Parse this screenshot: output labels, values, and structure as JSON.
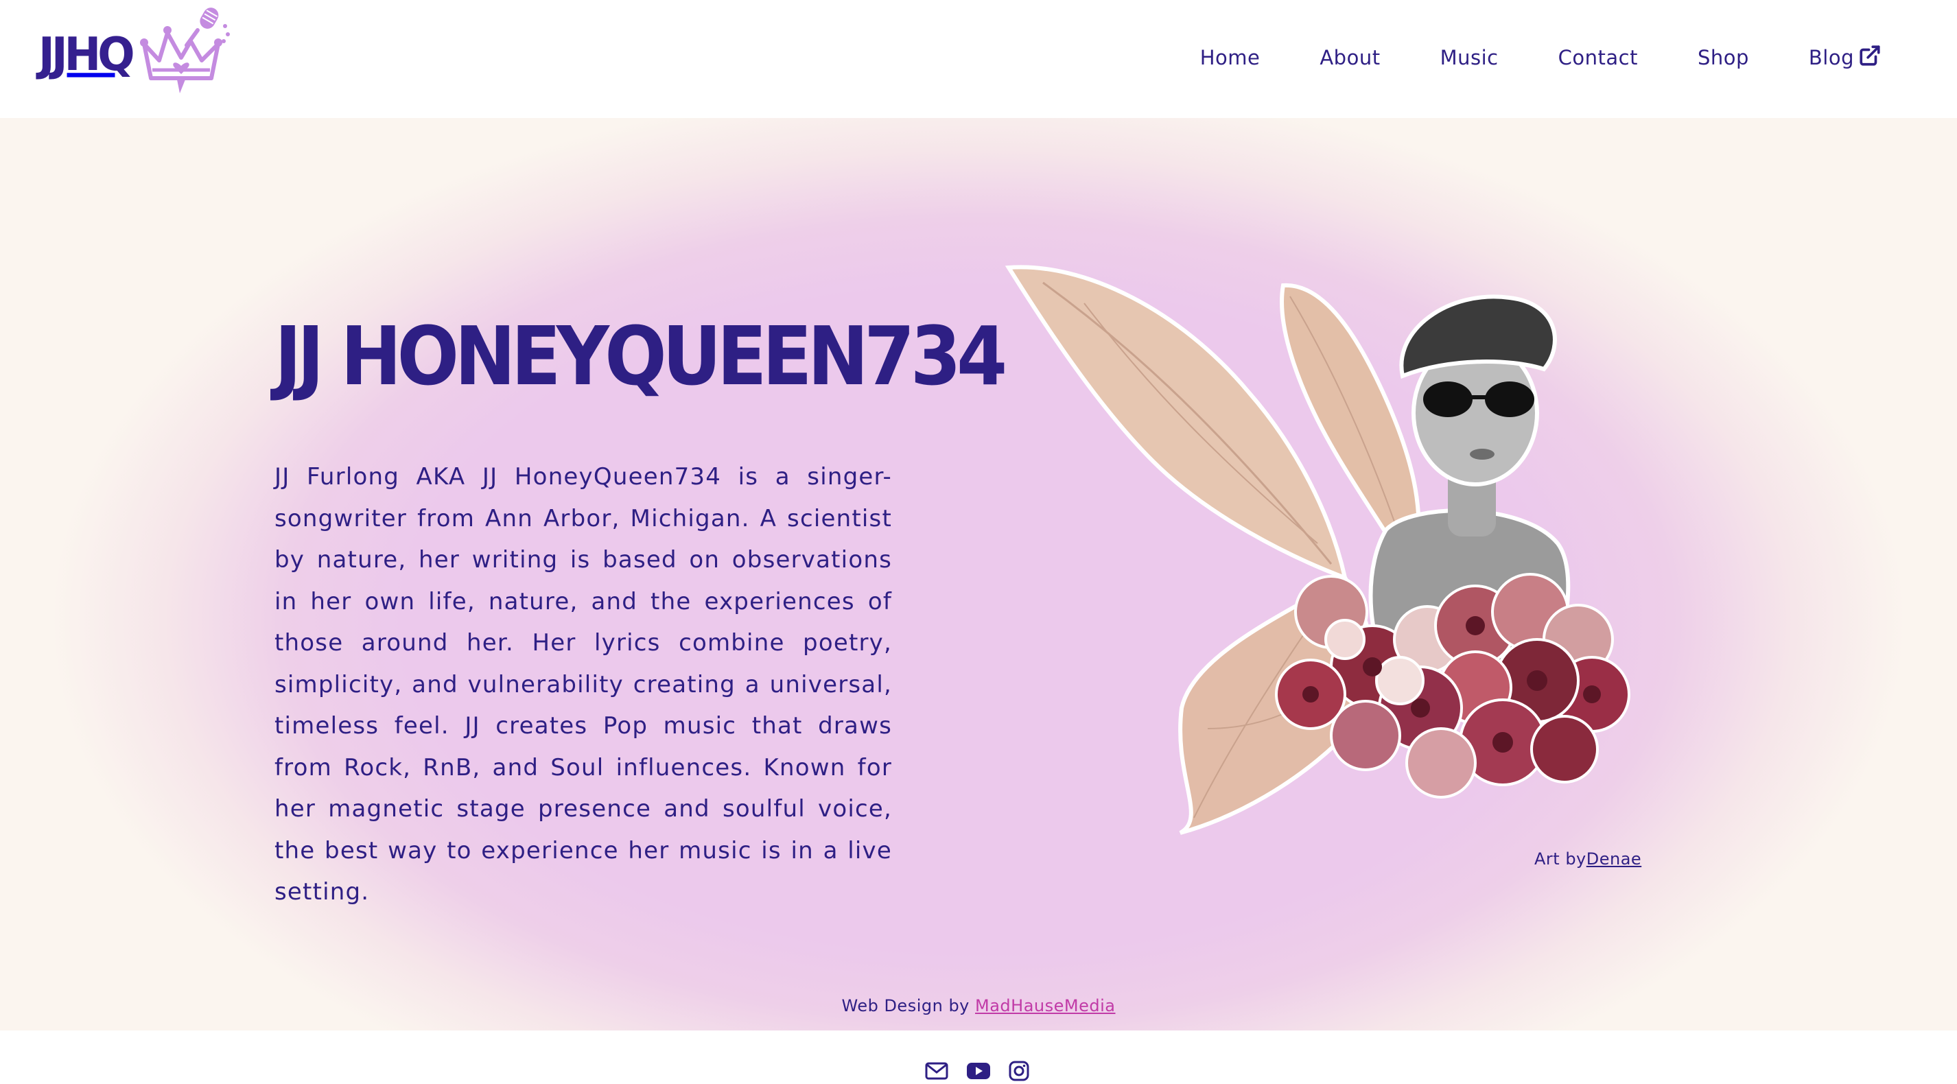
{
  "brand": {
    "logo_text": "JJHQ"
  },
  "nav": {
    "items": [
      {
        "label": "Home"
      },
      {
        "label": "About"
      },
      {
        "label": "Music"
      },
      {
        "label": "Contact"
      },
      {
        "label": "Shop"
      },
      {
        "label": "Blog"
      }
    ]
  },
  "hero": {
    "title": "JJ HONEYQUEEN734",
    "bio": "JJ Furlong AKA JJ HoneyQueen734 is a singer-songwriter from Ann Arbor, Michigan. A scientist by nature, her writing is based on observations in her own life, nature, and the experiences of those around her. Her lyrics combine poetry, simplicity, and vulnerability creating a universal, timeless feel. JJ creates Pop music that draws from Rock, RnB, and Soul influences. Known for her magnetic stage presence and soulful voice, the best way to experience her music is in a live setting.",
    "art_credit_prefix": "Art by",
    "art_credit_name": "Denae"
  },
  "credits": {
    "webdesign_prefix": "Web Design by ",
    "webdesign_name": "MadHauseMedia"
  },
  "footer": {
    "icons": [
      "mail-icon",
      "youtube-icon",
      "instagram-icon"
    ]
  },
  "colors": {
    "brand_purple": "#2e1f84",
    "hero_pink": "#ecc9ec",
    "link_magenta": "#c13aa7",
    "crown_lavender": "#c48be0"
  }
}
